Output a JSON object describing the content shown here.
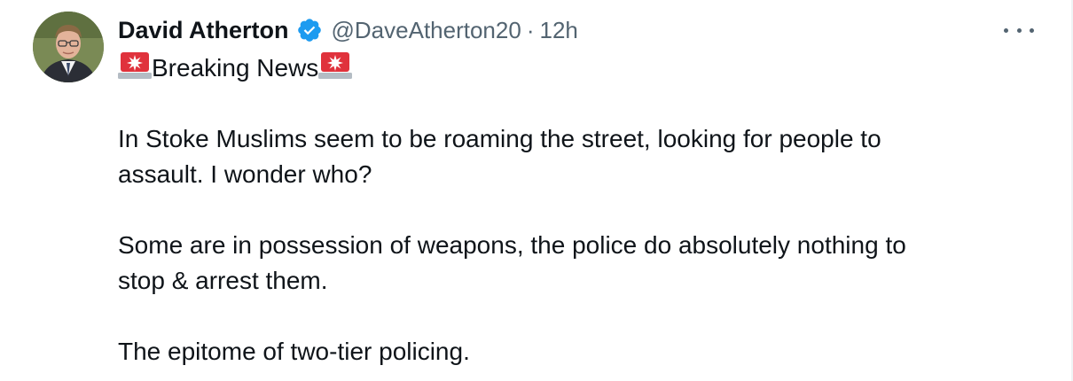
{
  "tweet": {
    "author": {
      "display_name": "David Atherton",
      "handle": "@DaveAtherton20",
      "verified": true
    },
    "separator": "·",
    "time": "12h",
    "headline": "Breaking News",
    "paragraphs": [
      [
        "In Stoke Muslims seem to be roaming the street, looking for people to",
        "assault. I wonder who?"
      ],
      [
        "Some are in possession of weapons, the police do absolutely nothing to",
        "stop & arrest them."
      ],
      [
        "The epitome of two-tier policing."
      ]
    ]
  },
  "icons": {
    "verified": "verified-badge-icon",
    "siren": "police-car-light-icon",
    "more": "more-options-icon"
  },
  "colors": {
    "text": "#0f1419",
    "secondary": "#536471",
    "verified_blue": "#1d9bf0",
    "siren_red": "#e0323c"
  }
}
